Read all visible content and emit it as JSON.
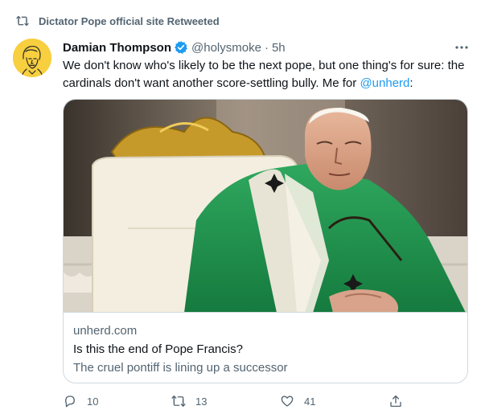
{
  "retweet_banner": {
    "text": "Dictator Pope official site Retweeted",
    "icon": "retweet-icon"
  },
  "tweet": {
    "author": {
      "name": "Damian Thompson",
      "handle": "@holysmoke",
      "verified": true,
      "avatar": "sketch-portrait-yellow"
    },
    "separator": "·",
    "time": "5h",
    "text_main": "We don't know who's likely to be the next pope, but one thing's for sure: the cardinals don't want another score-settling bully. Me for ",
    "mention": "@unherd",
    "text_end": ":",
    "more_icon": "more-icon"
  },
  "card": {
    "domain": "unherd.com",
    "title": "Is this the end of Pope Francis?",
    "description": "The cruel pontiff is lining up a successor"
  },
  "actions": {
    "reply": {
      "icon": "reply-icon",
      "count": "10"
    },
    "retweet": {
      "icon": "retweet-icon",
      "count": "13"
    },
    "like": {
      "icon": "heart-icon",
      "count": "41"
    },
    "share": {
      "icon": "share-icon"
    }
  },
  "colors": {
    "accent": "#1d9bf0",
    "secondary_text": "#536471",
    "primary_text": "#0f1419",
    "border": "#cfd9de",
    "avatar_bg": "#f7cf3f"
  }
}
